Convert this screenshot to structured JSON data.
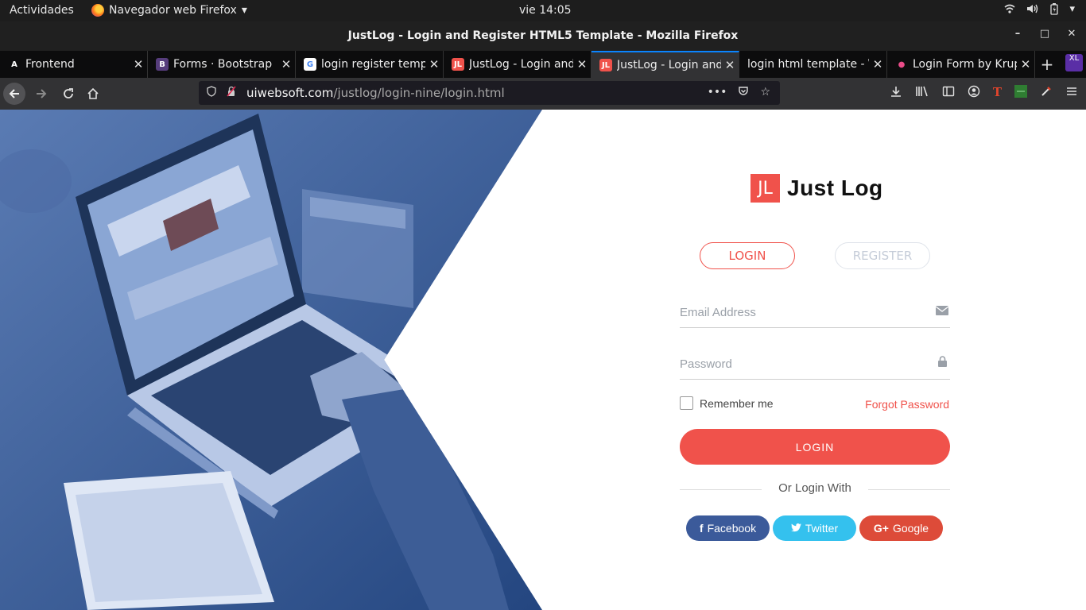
{
  "system": {
    "activities": "Actividades",
    "app_name": "Navegador web Firefox",
    "clock": "vie 14:05"
  },
  "window": {
    "title": "JustLog - Login and Register HTML5 Template - Mozilla Firefox",
    "minimize": "–",
    "maximize": "□",
    "close": "✕"
  },
  "tabs": [
    {
      "icon": "A",
      "label": "Frontend",
      "icon_bg": "#0c0c0d",
      "icon_fg": "#ffffff"
    },
    {
      "icon": "B",
      "label": "Forms · Bootstrap",
      "icon_bg": "#563d7c",
      "icon_fg": "#ffffff"
    },
    {
      "icon": "G",
      "label": "login register temp",
      "icon_bg": "#ffffff",
      "icon_fg": "#4285f4"
    },
    {
      "icon": "JL",
      "label": "JustLog - Login and",
      "icon_bg": "#f0524b",
      "icon_fg": "#ffffff"
    },
    {
      "icon": "JL",
      "label": "JustLog - Login and",
      "icon_bg": "#f0524b",
      "icon_fg": "#ffffff",
      "active": true
    },
    {
      "icon": "",
      "label": "login html template - \\",
      "icon_bg": "transparent",
      "icon_fg": "#ffffff"
    },
    {
      "icon": "●",
      "label": "Login Form by Krup",
      "icon_bg": "transparent",
      "icon_fg": "#ea4c89"
    }
  ],
  "tab_close": "✕",
  "new_tab": "+",
  "xl_badge": "XL",
  "url": {
    "host": "uiwebsoft.com",
    "path": "/justlog/login-nine/login.html"
  },
  "page": {
    "logo_mark": "JL",
    "logo_name": "Just Log",
    "tab_login": "LOGIN",
    "tab_register": "REGISTER",
    "email_placeholder": "Email Address",
    "password_placeholder": "Password",
    "remember": "Remember me",
    "forgot": "Forgot Password",
    "submit": "LOGIN",
    "or_login_with": "Or Login With",
    "facebook": "Facebook",
    "twitter": "Twitter",
    "google": "Google"
  },
  "colors": {
    "accent": "#f0524b",
    "hero_blue": "#2d4f8f",
    "facebook": "#3b5a9a",
    "twitter": "#34c1ee",
    "google": "#dd4b39"
  }
}
